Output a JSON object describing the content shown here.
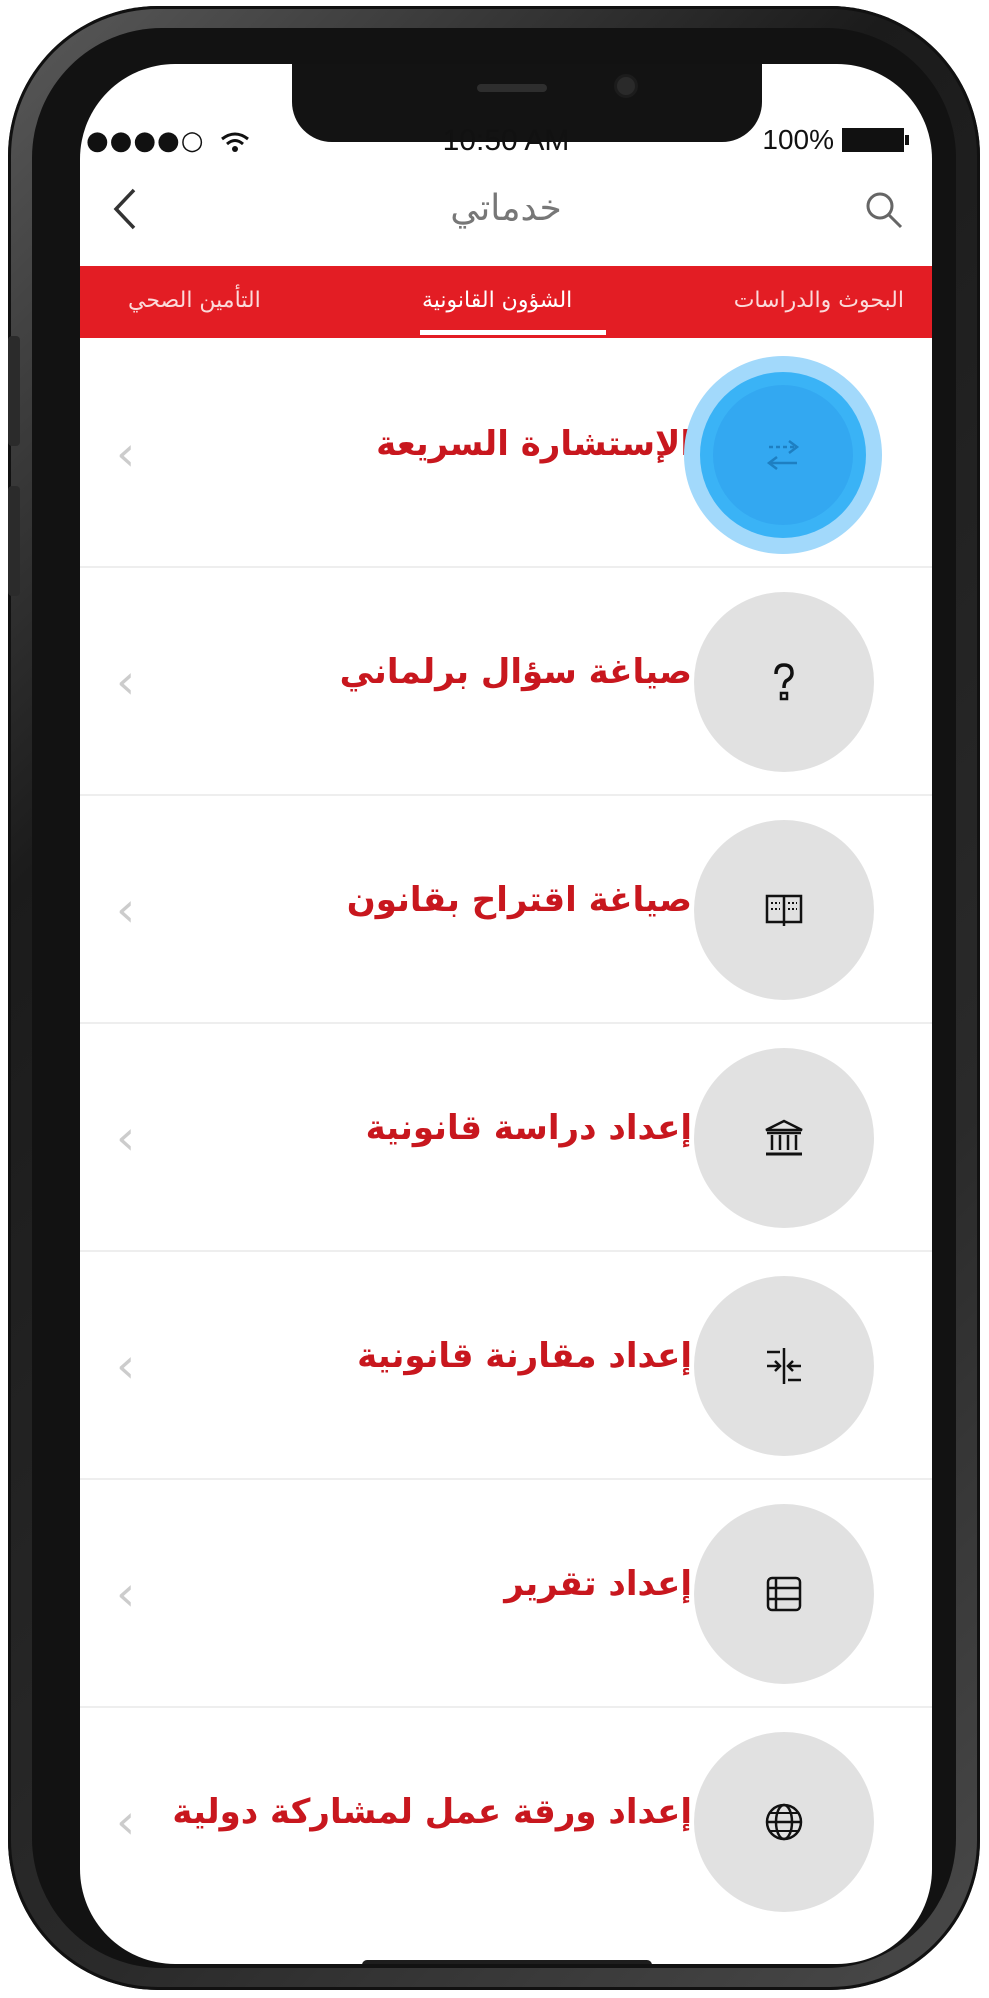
{
  "status_bar": {
    "signal": "●●●●○",
    "time": "10:50 AM",
    "battery": "100%"
  },
  "nav": {
    "back_label": "<",
    "title": "خدماتي"
  },
  "tabs": [
    {
      "label": "البحوث والدراسات",
      "active": false
    },
    {
      "label": "الشؤون القانونية",
      "active": true
    },
    {
      "label": "التأمين الصحي",
      "active": false
    }
  ],
  "services": [
    {
      "label": "الإستشارة السريعة",
      "icon": "swap-arrows-icon",
      "active": true
    },
    {
      "label": "صياغة سؤال برلماني",
      "icon": "question-icon",
      "active": false
    },
    {
      "label": "صياغة اقتراح بقانون",
      "icon": "open-book-icon",
      "active": false
    },
    {
      "label": "إعداد دراسة قانونية",
      "icon": "institution-icon",
      "active": false
    },
    {
      "label": "إعداد مقارنة قانونية",
      "icon": "compare-arrows-icon",
      "active": false
    },
    {
      "label": "إعداد تقرير",
      "icon": "list-icon",
      "active": false
    },
    {
      "label": "إعداد ورقة عمل لمشاركة دولية",
      "icon": "globe-icon",
      "active": false
    }
  ],
  "chevron": "‹",
  "colors": {
    "accent": "#e31d24",
    "label_red": "#c8171e",
    "highlight_blue": "#3ab3f6",
    "icon_circle": "#e1e1e1"
  }
}
